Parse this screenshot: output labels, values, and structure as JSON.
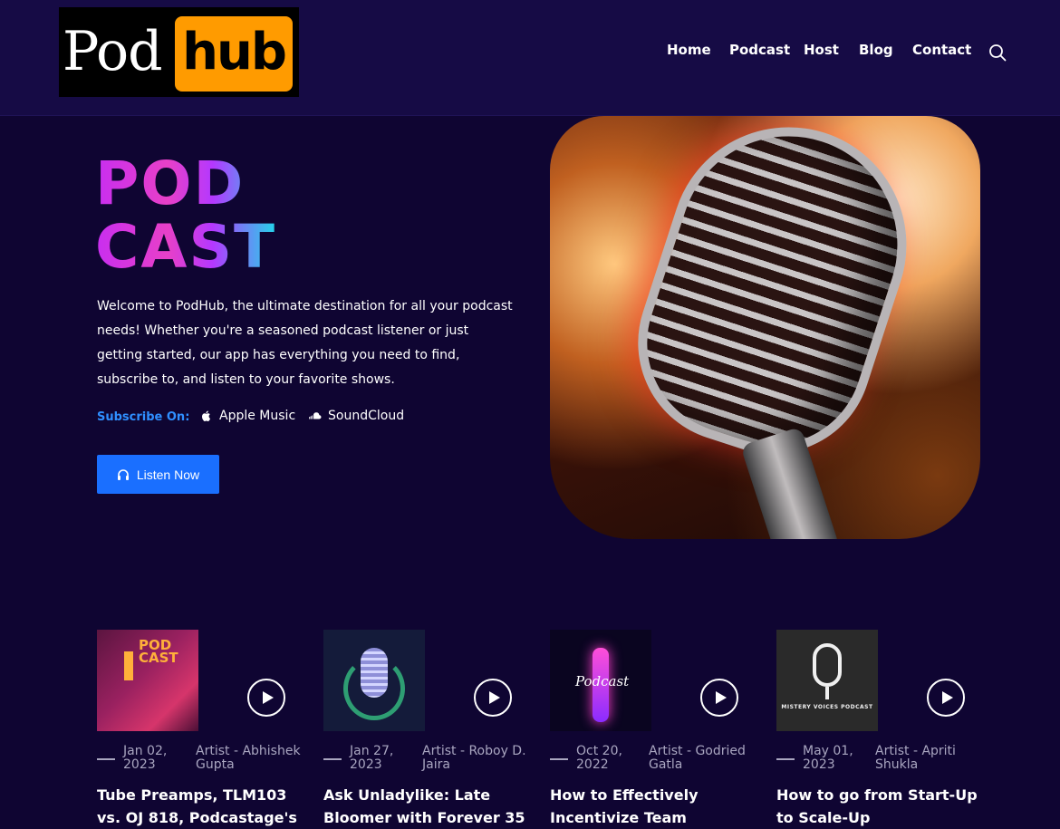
{
  "brand": {
    "logo_word1": "Pod",
    "logo_word2": "hub",
    "accent": "#ff9b00"
  },
  "nav": {
    "items": [
      "Home",
      "Podcast",
      "Host",
      "Blog",
      "Contact"
    ],
    "search_icon": "search-icon"
  },
  "hero": {
    "title_line1": "POD",
    "title_line2": "CAST",
    "description": "Welcome to PodHub, the ultimate destination for all your podcast needs! Whether you're a seasoned podcast listener or just getting started, our app has everything you need to find, subscribe to, and listen to your favorite shows.",
    "subscribe_label": "Subscribe On:",
    "subscribe_links": [
      {
        "label": "Apple Music",
        "icon": "apple-icon"
      },
      {
        "label": "SoundCloud",
        "icon": "soundcloud-icon"
      }
    ],
    "cta_label": "Listen Now",
    "cta_icon": "headphones-icon",
    "cta_color": "#1a6fff"
  },
  "episodes": [
    {
      "thumb_text": "POD CAST",
      "date": "Jan 02, 2023",
      "artist": "Artist - Abhishek Gupta",
      "title": "Tube Preamps, TLM103 vs. OJ 818, Podcastage's"
    },
    {
      "date": "Jan 27, 2023",
      "artist": "Artist - Roboy D. Jaira",
      "title": "Ask Unladylike: Late Bloomer with Forever 35"
    },
    {
      "thumb_text": "Podcast",
      "date": "Oct 20, 2022",
      "artist": "Artist - Godried Gatla",
      "title": "How to Effectively Incentivize Team Members"
    },
    {
      "thumb_text": "MISTERY VOICES PODCAST",
      "date": "May 01, 2023",
      "artist": "Artist - Apriti Shukla",
      "title": "How to go from Start-Up to Scale-Up"
    }
  ]
}
